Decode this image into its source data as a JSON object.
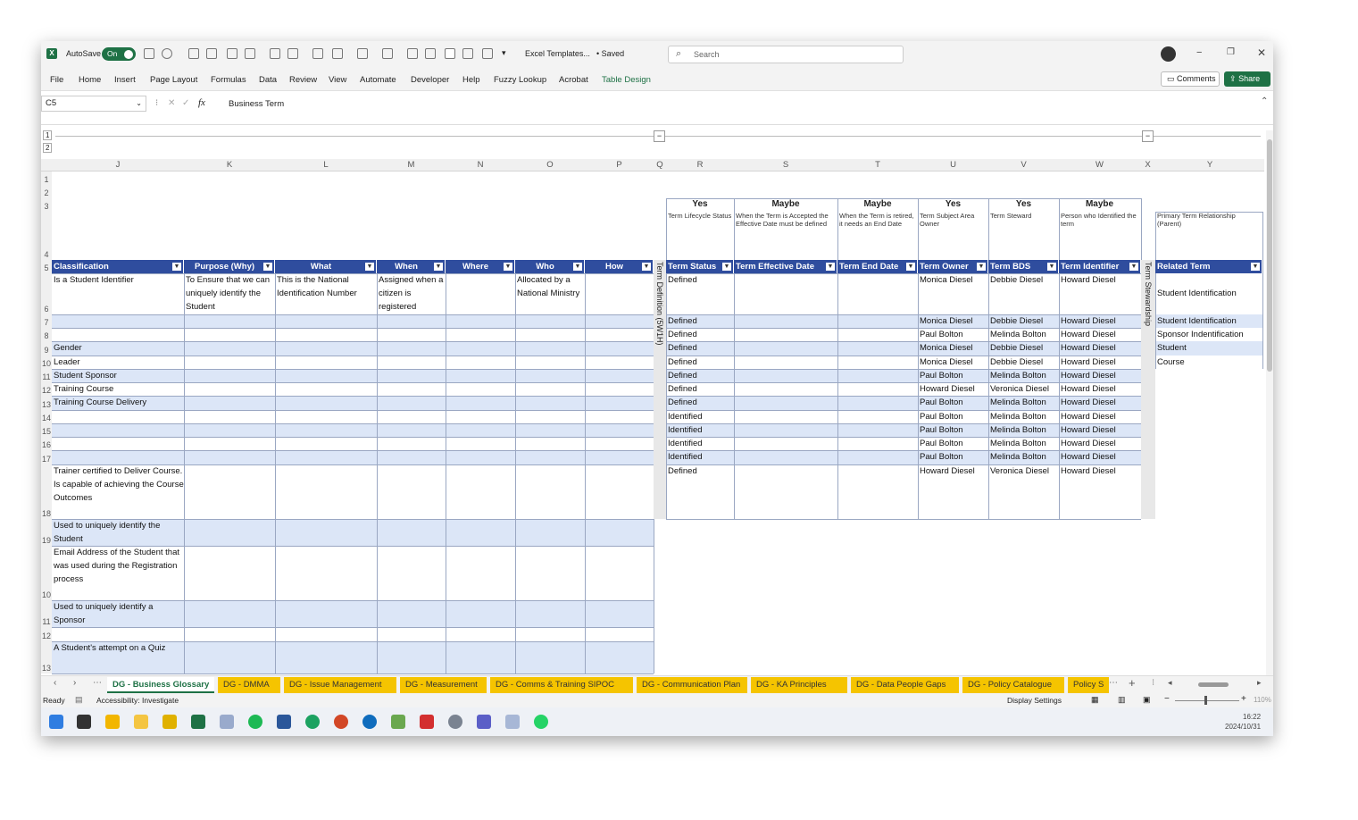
{
  "titlebar": {
    "autosave_label": "AutoSave",
    "autosave_state": "On",
    "file_name": "Excel Templates...",
    "save_status": "• Saved",
    "search_placeholder": "Search"
  },
  "menu": [
    "File",
    "Home",
    "Insert",
    "Page Layout",
    "Formulas",
    "Data",
    "Review",
    "View",
    "Automate",
    "Developer",
    "Help",
    "Fuzzy Lookup",
    "Acrobat",
    "Table Design"
  ],
  "menu_active_color": "#1e7145",
  "comments_label": "Comments",
  "share_label": "Share",
  "formula": {
    "name_box": "C5",
    "fx": "fx",
    "value": "Business Term"
  },
  "col_letters": [
    "J",
    "K",
    "L",
    "M",
    "N",
    "O",
    "P",
    "Q",
    "R",
    "S",
    "T",
    "U",
    "V",
    "W",
    "X",
    "Y"
  ],
  "row_numbers": [
    "1",
    "2",
    "3",
    "4",
    "5",
    "6",
    "7",
    "8",
    "9",
    "10",
    "11",
    "12",
    "13",
    "14",
    "15",
    "16",
    "17",
    "18",
    "19",
    "10",
    "11",
    "12",
    "13"
  ],
  "outline_levels": [
    "1",
    "2"
  ],
  "top_flags": [
    "Yes",
    "Maybe",
    "Maybe",
    "Yes",
    "Yes",
    "Maybe"
  ],
  "notes": [
    "Term Lifecycle Status",
    "When the Term is Accepted the Effective Date must be defined",
    "When the Term is retired, it needs an End Date",
    "Term Subject Area Owner",
    "Term Steward",
    "Person who Identified the term",
    "Primary Term Relationship (Parent)"
  ],
  "left_headers": [
    "Classification",
    "Purpose (Why)",
    "What",
    "When",
    "Where",
    "Who",
    "How"
  ],
  "right_headers": [
    "Term Status",
    "Term Effective Date",
    "Term End Date",
    "Term Owner",
    "Term BDS",
    "Term Identifier",
    "Related Term"
  ],
  "side_labels": {
    "definition": "Term Definition (5W1H)",
    "stewardship": "Term Stewardship"
  },
  "left_rows": [
    {
      "c": "Is a Student Identifier",
      "k": "To Ensure that we can uniquely identify the Student",
      "l": "This is the National Identification Number",
      "m": "Assigned when a citizen is registered",
      "o": "Allocated by a National Ministry"
    },
    {
      "c": ""
    },
    {
      "c": ""
    },
    {
      "c": "Gender"
    },
    {
      "c": "Leader"
    },
    {
      "c": "Student Sponsor"
    },
    {
      "c": "Training Course"
    },
    {
      "c": "Training Course Delivery"
    },
    {
      "c": ""
    },
    {
      "c": ""
    },
    {
      "c": ""
    },
    {
      "c": ""
    },
    {
      "c": "Trainer certified to Deliver Course. Is capable of achieving the Course Outcomes"
    },
    {
      "c": "Used to uniquely identify the Student"
    },
    {
      "c": "Email Address of the Student that was used during the Registration process"
    },
    {
      "c": "Used to uniquely identify a Sponsor"
    },
    {
      "c": ""
    },
    {
      "c": "A Student's attempt on a Quiz"
    }
  ],
  "right_rows": [
    [
      "Defined",
      "Monica Diesel",
      "Debbie Diesel",
      "Howard Diesel",
      "Student Identification"
    ],
    [
      "Defined",
      "Monica Diesel",
      "Debbie Diesel",
      "Howard Diesel",
      "Student Identification"
    ],
    [
      "Defined",
      "Paul Bolton",
      "Melinda Bolton",
      "Howard Diesel",
      "Sponsor Indentification"
    ],
    [
      "Defined",
      "Monica Diesel",
      "Debbie Diesel",
      "Howard Diesel",
      "Student"
    ],
    [
      "Defined",
      "Monica Diesel",
      "Debbie Diesel",
      "Howard Diesel",
      "Course"
    ],
    [
      "Defined",
      "Paul Bolton",
      "Melinda Bolton",
      "Howard Diesel",
      ""
    ],
    [
      "Defined",
      "Howard Diesel",
      "Veronica Diesel",
      "Howard Diesel",
      ""
    ],
    [
      "Defined",
      "Paul Bolton",
      "Melinda Bolton",
      "Howard Diesel",
      ""
    ],
    [
      "Identified",
      "Paul Bolton",
      "Melinda Bolton",
      "Howard Diesel",
      ""
    ],
    [
      "Identified",
      "Paul Bolton",
      "Melinda Bolton",
      "Howard Diesel",
      ""
    ],
    [
      "Identified",
      "Paul Bolton",
      "Melinda Bolton",
      "Howard Diesel",
      ""
    ],
    [
      "Identified",
      "Paul Bolton",
      "Melinda Bolton",
      "Howard Diesel",
      ""
    ],
    [
      "Defined",
      "Howard Diesel",
      "Veronica Diesel",
      "Howard Diesel",
      ""
    ]
  ],
  "sheet_tabs": [
    "DG - Business Glossary",
    "DG - DMMA",
    "DG - Issue Management",
    "DG - Measurement",
    "DG - Comms & Training SIPOC",
    "DG - Communication Plan",
    "DG - KA Principles",
    "DG - Data People Gaps",
    "DG - Policy Catalogue",
    "Policy S"
  ],
  "status": {
    "ready": "Ready",
    "accessibility": "Accessibility: Investigate",
    "display": "Display Settings",
    "zoom": "110%"
  },
  "clock": {
    "time": "16:22",
    "date": "2024/10/31"
  },
  "colors": {
    "header_blue": "#2f4d9e",
    "band_blue": "#dce6f7",
    "tab_yellow": "#f5c400",
    "excel_green": "#1e7145"
  }
}
